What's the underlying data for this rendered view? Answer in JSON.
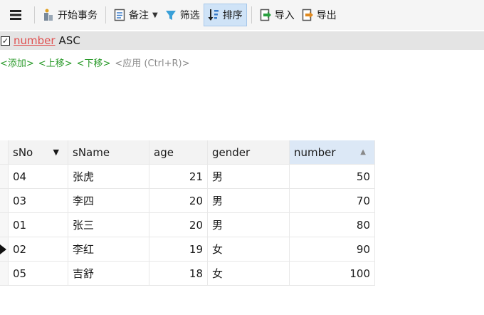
{
  "toolbar": {
    "begin_tx": "开始事务",
    "memo": "备注",
    "filter": "筛选",
    "sort": "排序",
    "import": "导入",
    "export": "导出"
  },
  "sortbar": {
    "field": "number",
    "direction": "ASC"
  },
  "actions": {
    "add": "<添加>",
    "up": "<上移>",
    "down": "<下移>",
    "apply": "<应用 (Ctrl+R)>"
  },
  "table": {
    "columns": [
      "sNo",
      "sName",
      "age",
      "gender",
      "number"
    ],
    "rows": [
      [
        "04",
        "张虎",
        "21",
        "男",
        "50"
      ],
      [
        "03",
        "李四",
        "20",
        "男",
        "70"
      ],
      [
        "01",
        "张三",
        "20",
        "男",
        "80"
      ],
      [
        "02",
        "李红",
        "19",
        "女",
        "90"
      ],
      [
        "05",
        "吉舒",
        "18",
        "女",
        "100"
      ]
    ],
    "current_row_index": 3
  },
  "colors": {
    "accent_green": "#2a9a2a",
    "sort_field_red": "#e05050",
    "sorted_header": "#dce8f6"
  }
}
